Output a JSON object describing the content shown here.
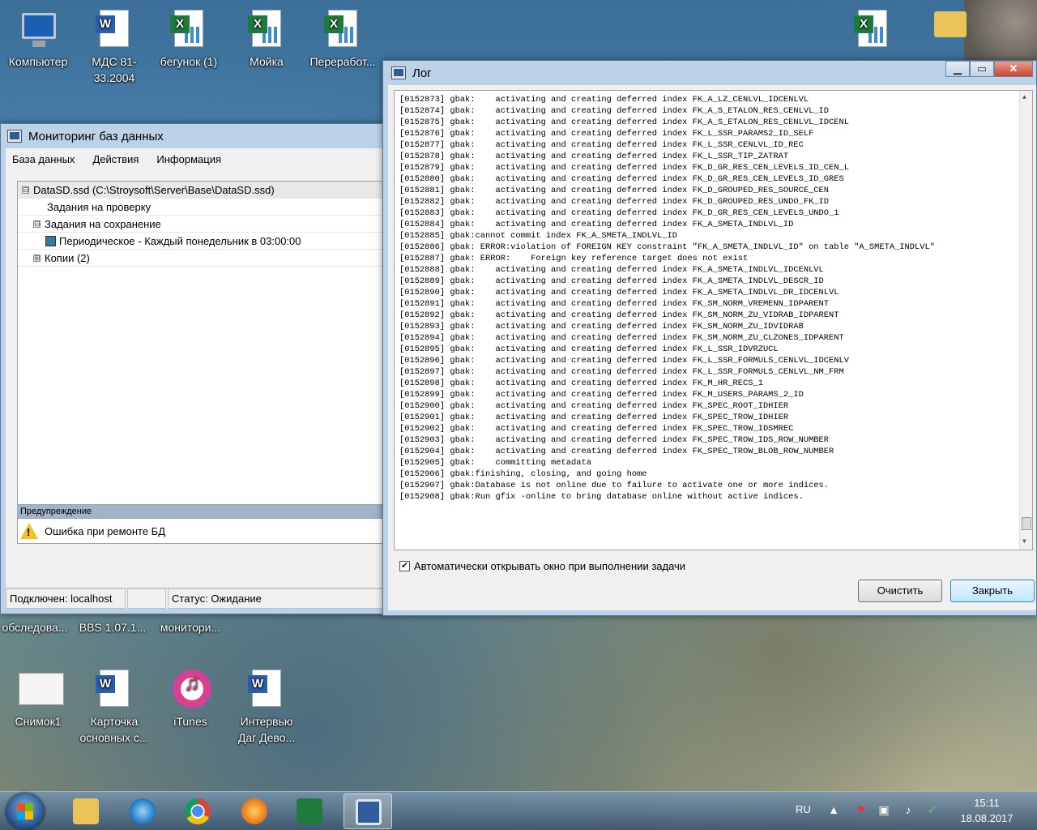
{
  "desktop": {
    "icons_top": [
      {
        "label": "Компьютер"
      },
      {
        "label": "МДС 81-33.2004"
      },
      {
        "label": "бегунок (1)"
      },
      {
        "label": "Мойка"
      },
      {
        "label": "Переработ..."
      }
    ],
    "icons_mid": [
      {
        "label": "обследова..."
      },
      {
        "label": "BBS 1.07.1..."
      },
      {
        "label": "монитори..."
      }
    ],
    "icons_bottom": [
      {
        "label": "Снимок1"
      },
      {
        "label": "Карточка основных с..."
      },
      {
        "label": "iTunes"
      },
      {
        "label": "Интервью Даг Дево..."
      }
    ]
  },
  "monitor_window": {
    "title": "Мониторинг баз данных",
    "menu": [
      "База данных",
      "Действия",
      "Информация"
    ],
    "tree": [
      {
        "text": "DataSD.ssd (C:\\Stroysoft\\Server\\Base\\DataSD.ssd)",
        "expander": "⊟"
      },
      {
        "text": "Задания на проверку",
        "expander": ""
      },
      {
        "text": "Задания на сохранение",
        "expander": "⊟"
      },
      {
        "text": "Периодическое - Каждый понедельник в 03:00:00",
        "expander": ""
      },
      {
        "text": "Копии (2)",
        "expander": "⊞"
      }
    ],
    "warning_header": "Предупреждение",
    "warning_text": "Ошибка при ремонте БД",
    "status_connected": "Подключен: localhost",
    "status_state": "Статус: Ожидание"
  },
  "log_window": {
    "title": "Лог",
    "lines": [
      "[0152873] gbak:    activating and creating deferred index FK_A_LZ_CENLVL_IDCENLVL",
      "[0152874] gbak:    activating and creating deferred index FK_A_S_ETALON_RES_CENLVL_ID",
      "[0152875] gbak:    activating and creating deferred index FK_A_S_ETALON_RES_CENLVL_IDCENL",
      "[0152876] gbak:    activating and creating deferred index FK_L_SSR_PARAMS2_ID_SELF",
      "[0152877] gbak:    activating and creating deferred index FK_L_SSR_CENLVL_ID_REC",
      "[0152878] gbak:    activating and creating deferred index FK_L_SSR_TIP_ZATRAT",
      "[0152879] gbak:    activating and creating deferred index FK_D_GR_RES_CEN_LEVELS_ID_CEN_L",
      "[0152880] gbak:    activating and creating deferred index FK_D_GR_RES_CEN_LEVELS_ID_GRES",
      "[0152881] gbak:    activating and creating deferred index FK_D_GROUPED_RES_SOURCE_CEN",
      "[0152882] gbak:    activating and creating deferred index FK_D_GROUPED_RES_UNDO_FK_ID",
      "[0152883] gbak:    activating and creating deferred index FK_D_GR_RES_CEN_LEVELS_UNDO_1",
      "[0152884] gbak:    activating and creating deferred index FK_A_SMETA_INDLVL_ID",
      "[0152885] gbak:cannot commit index FK_A_SMETA_INDLVL_ID",
      "[0152886] gbak: ERROR:violation of FOREIGN KEY constraint \"FK_A_SMETA_INDLVL_ID\" on table \"A_SMETA_INDLVL\"",
      "[0152887] gbak: ERROR:    Foreign key reference target does not exist",
      "[0152888] gbak:    activating and creating deferred index FK_A_SMETA_INDLVL_IDCENLVL",
      "[0152889] gbak:    activating and creating deferred index FK_A_SMETA_INDLVL_DESCR_ID",
      "[0152890] gbak:    activating and creating deferred index FK_A_SMETA_INDLVL_DR_IDCENLVL",
      "[0152891] gbak:    activating and creating deferred index FK_SM_NORM_VREMENN_IDPARENT",
      "[0152892] gbak:    activating and creating deferred index FK_SM_NORM_ZU_VIDRAB_IDPARENT",
      "[0152893] gbak:    activating and creating deferred index FK_SM_NORM_ZU_IDVIDRAB",
      "[0152894] gbak:    activating and creating deferred index FK_SM_NORM_ZU_CLZONES_IDPARENT",
      "[0152895] gbak:    activating and creating deferred index FK_L_SSR_IDVRZUCL",
      "[0152896] gbak:    activating and creating deferred index FK_L_SSR_FORMULS_CENLVL_IDCENLV",
      "[0152897] gbak:    activating and creating deferred index FK_L_SSR_FORMULS_CENLVL_NM_FRM",
      "[0152898] gbak:    activating and creating deferred index FK_M_HR_RECS_1",
      "[0152899] gbak:    activating and creating deferred index FK_M_USERS_PARAMS_2_ID",
      "[0152900] gbak:    activating and creating deferred index FK_SPEC_ROOT_IDHIER",
      "[0152901] gbak:    activating and creating deferred index FK_SPEC_TROW_IDHIER",
      "[0152902] gbak:    activating and creating deferred index FK_SPEC_TROW_IDSMREC",
      "[0152903] gbak:    activating and creating deferred index FK_SPEC_TROW_IDS_ROW_NUMBER",
      "[0152904] gbak:    activating and creating deferred index FK_SPEC_TROW_BLOB_ROW_NUMBER",
      "[0152905] gbak:    committing metadata",
      "[0152906] gbak:finishing, closing, and going home",
      "[0152907] gbak:Database is not online due to failure to activate one or more indices.",
      "[0152908] gbak:Run gfix -online to bring database online without active indices."
    ],
    "auto_open_label": "Автоматически открывать окно при выполнении задачи",
    "clear_button": "Очистить",
    "close_button": "Закрыть"
  },
  "taskbar": {
    "language": "RU",
    "time": "15:11",
    "date": "18.08.2017"
  }
}
